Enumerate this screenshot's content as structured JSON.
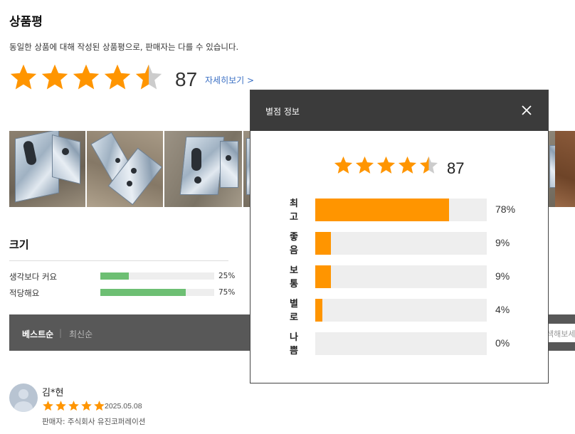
{
  "page": {
    "title": "상품평",
    "description": "동일한 상품에 대해 작성된 상품평으로, 판매자는 다를 수 있습니다.",
    "rating_stars": 4.5,
    "review_count": "87",
    "detail_link": "자세히보기 >"
  },
  "size": {
    "title": "크기",
    "rows": [
      {
        "label": "생각보다 커요",
        "percent": "25%",
        "value": 25
      },
      {
        "label": "적당해요",
        "percent": "75%",
        "value": 75
      }
    ]
  },
  "sort": {
    "best": "베스트순",
    "separator": "|",
    "newest": "최신순",
    "search_placeholder": "색해보세"
  },
  "review": {
    "name": "김*현",
    "stars": 5,
    "date": "2025.05.08",
    "seller": "판매자: 주식회사 유진코퍼레이션"
  },
  "modal": {
    "title": "별점 정보",
    "count": "87",
    "stars": 4.5,
    "rows": [
      {
        "label": [
          "최",
          "고"
        ],
        "percent": "78%",
        "value": 78
      },
      {
        "label": [
          "좋",
          "음"
        ],
        "percent": "9%",
        "value": 9
      },
      {
        "label": [
          "보",
          "통"
        ],
        "percent": "9%",
        "value": 9
      },
      {
        "label": [
          "별",
          "로"
        ],
        "percent": "4%",
        "value": 4
      },
      {
        "label": [
          "나",
          "쁨"
        ],
        "percent": "0%",
        "value": 0
      }
    ]
  },
  "colors": {
    "star": "#ff9500",
    "star_empty": "#cccccc",
    "size_bar": "#6dbf73",
    "rating_bar": "#ff9500",
    "sort_bar": "#585858",
    "modal_header": "#3b3b3b",
    "link": "#3a6fc4"
  },
  "icons": {
    "star": "star-icon",
    "close": "close-icon",
    "avatar": "user-avatar-icon"
  }
}
